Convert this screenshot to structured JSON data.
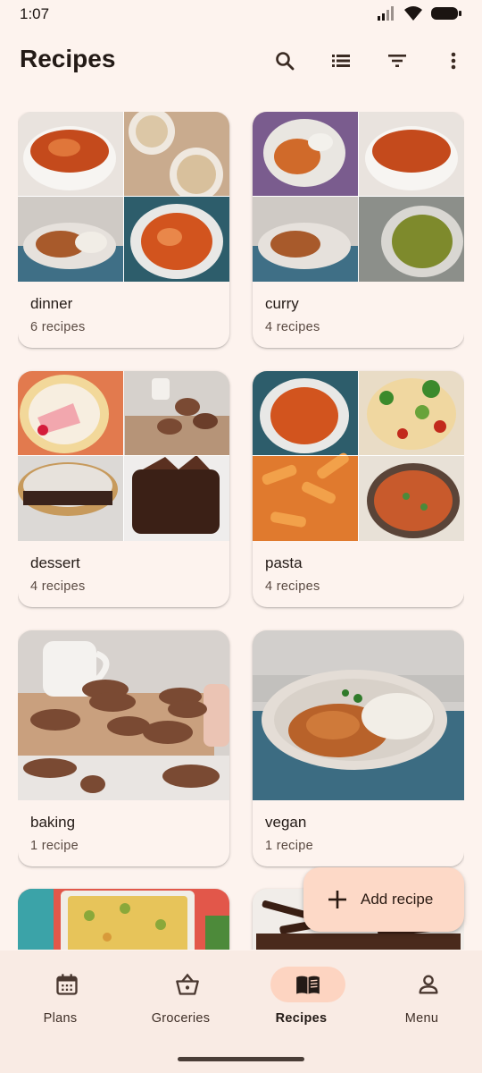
{
  "status_bar": {
    "time": "1:07"
  },
  "header": {
    "title": "Recipes"
  },
  "collections": [
    {
      "title": "dinner",
      "count_label": "6 recipes"
    },
    {
      "title": "curry",
      "count_label": "4 recipes"
    },
    {
      "title": "dessert",
      "count_label": "4 recipes"
    },
    {
      "title": "pasta",
      "count_label": "4 recipes"
    },
    {
      "title": "baking",
      "count_label": "1 recipe"
    },
    {
      "title": "vegan",
      "count_label": "1 recipe"
    },
    {
      "title": "",
      "count_label": ""
    },
    {
      "title": "",
      "count_label": ""
    }
  ],
  "fab": {
    "label": "Add recipe",
    "icon": "plus-icon"
  },
  "bottom_nav": [
    {
      "label": "Plans",
      "icon": "calendar-icon",
      "active": false
    },
    {
      "label": "Groceries",
      "icon": "basket-icon",
      "active": false
    },
    {
      "label": "Recipes",
      "icon": "book-icon",
      "active": true
    },
    {
      "label": "Menu",
      "icon": "person-icon",
      "active": false
    }
  ],
  "colors": {
    "background": "#fdf3ee",
    "accent": "#fdd9c7",
    "nav_active": "#fdd4c1",
    "text": "#231a16"
  }
}
